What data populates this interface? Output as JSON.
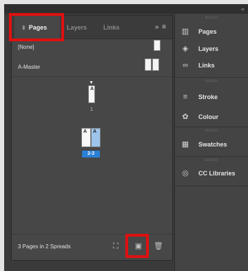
{
  "window": {
    "collapse_glyph": "«"
  },
  "pages_panel": {
    "tabs": [
      {
        "label": "Pages",
        "handle": "⇕"
      },
      {
        "label": "Layers"
      },
      {
        "label": "Links"
      }
    ],
    "menu_glyph": "»  ≡",
    "masters": [
      {
        "label": "[None]"
      },
      {
        "label": "A-Master"
      }
    ],
    "page1": {
      "master_letter": "A",
      "number": "1"
    },
    "spread2": {
      "left_letter": "A",
      "right_letter": "A",
      "number": "2-3"
    },
    "summary": "3 Pages in 2 Spreads",
    "bottom_icons": [
      "edit-page-size-icon",
      "new-page-icon",
      "delete-page-icon"
    ]
  },
  "dock": {
    "items": [
      {
        "label": "Pages",
        "icon": "pages-icon"
      },
      {
        "label": "Layers",
        "icon": "layers-icon"
      },
      {
        "label": "Links",
        "icon": "links-icon"
      },
      {
        "label": "Stroke",
        "icon": "stroke-icon"
      },
      {
        "label": "Colour",
        "icon": "colour-icon"
      },
      {
        "label": "Swatches",
        "icon": "swatches-icon"
      },
      {
        "label": "CC Libraries",
        "icon": "cc-libraries-icon"
      }
    ]
  },
  "colors": {
    "highlight": "#e01010",
    "selection": "#2a7fd6",
    "panel_bg": "#474747"
  }
}
